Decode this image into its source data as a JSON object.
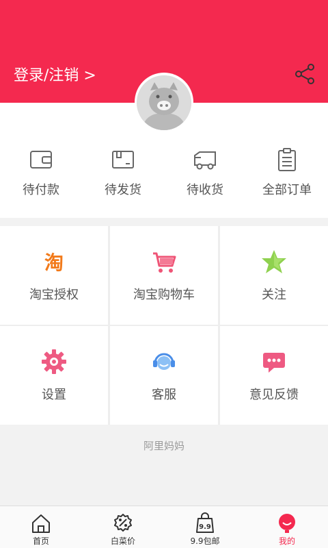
{
  "header": {
    "login_text": "登录/注销 >",
    "brand_color": "#f4294f",
    "share_icon": "share-icon",
    "avatar_icon": "pig-avatar-icon"
  },
  "orders": [
    {
      "label": "待付款",
      "icon": "wallet-icon"
    },
    {
      "label": "待发货",
      "icon": "package-icon"
    },
    {
      "label": "待收货",
      "icon": "truck-icon"
    },
    {
      "label": "全部订单",
      "icon": "clipboard-icon"
    }
  ],
  "grid": [
    {
      "label": "淘宝授权",
      "icon": "taobao-icon"
    },
    {
      "label": "淘宝购物车",
      "icon": "cart-icon"
    },
    {
      "label": "关注",
      "icon": "star-icon"
    },
    {
      "label": "设置",
      "icon": "gear-icon"
    },
    {
      "label": "客服",
      "icon": "headset-icon"
    },
    {
      "label": "意见反馈",
      "icon": "feedback-icon"
    }
  ],
  "taobao_glyph": "淘",
  "footer_text": "阿里妈妈",
  "nav": [
    {
      "label": "首页",
      "icon": "home-icon"
    },
    {
      "label": "白菜价",
      "icon": "discount-icon"
    },
    {
      "label": "9.9包邮",
      "icon": "shopping-bag-icon"
    },
    {
      "label": "我的",
      "icon": "profile-icon",
      "active": true
    }
  ],
  "nav_bag_text": "9.9"
}
